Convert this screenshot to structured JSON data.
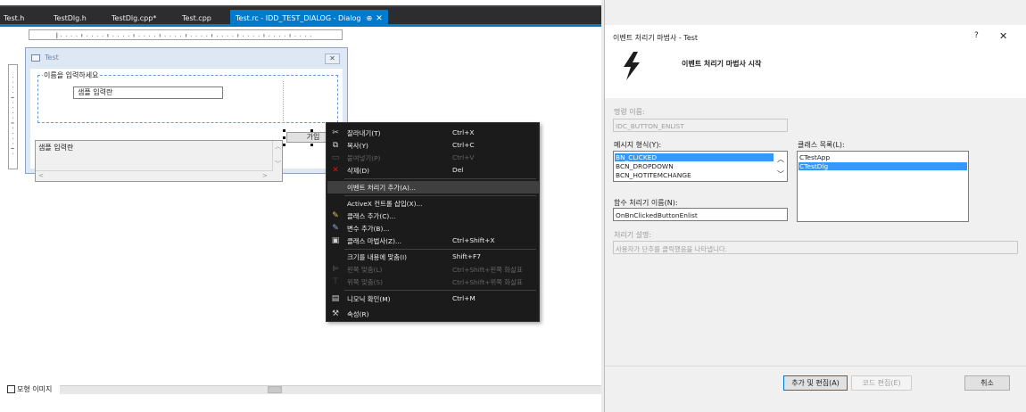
{
  "editor": {
    "tabs": [
      {
        "label": "Test.h"
      },
      {
        "label": "TestDlg.h"
      },
      {
        "label": "TestDlg.cpp*"
      },
      {
        "label": "Test.cpp"
      },
      {
        "label": "Test.rc - IDD_TEST_DIALOG - Dialog",
        "active": true
      }
    ],
    "active_tab_pin": "⊕",
    "active_tab_close": "✕",
    "dialog": {
      "title": "Test",
      "close_glyph": "✕",
      "group_label": "이름을 입력하세요",
      "edit_value": "샘플 입력란",
      "join_button": "가입",
      "list_label": "샘플 입력란"
    },
    "status": {
      "checkbox_label": "모형 이미지"
    }
  },
  "context_menu": {
    "items": [
      {
        "icon": "scissors-icon",
        "glyph": "✂",
        "label": "잘라내기(T)",
        "shortcut": "Ctrl+X",
        "enabled": true
      },
      {
        "icon": "copy-icon",
        "glyph": "⧉",
        "label": "복사(Y)",
        "shortcut": "Ctrl+C",
        "enabled": true
      },
      {
        "icon": "paste-icon",
        "glyph": "📋",
        "label": "붙여넣기(P)",
        "shortcut": "Ctrl+V",
        "enabled": false
      },
      {
        "icon": "delete-icon",
        "glyph": "✕",
        "label": "삭제(D)",
        "shortcut": "Del",
        "enabled": true
      },
      {
        "icon": "",
        "glyph": "",
        "label": "이벤트 처리기 추가(A)...",
        "shortcut": "",
        "enabled": true,
        "highlighted": true
      },
      {
        "icon": "",
        "glyph": "",
        "label": "ActiveX 컨트롤 삽입(X)...",
        "shortcut": "",
        "enabled": true
      },
      {
        "icon": "add-class-icon",
        "glyph": "✎",
        "label": "클래스 추가(C)...",
        "shortcut": "",
        "enabled": true
      },
      {
        "icon": "add-variable-icon",
        "glyph": "✎",
        "label": "변수 추가(B)...",
        "shortcut": "",
        "enabled": true
      },
      {
        "icon": "class-wizard-icon",
        "glyph": "▣",
        "label": "클래스 마법사(Z)...",
        "shortcut": "Ctrl+Shift+X",
        "enabled": true
      },
      {
        "icon": "",
        "glyph": "",
        "label": "크기를 내용에 맞춤(I)",
        "shortcut": "Shift+F7",
        "enabled": true
      },
      {
        "icon": "align-left-icon",
        "glyph": "⊫",
        "label": "왼쪽 맞춤(L)",
        "shortcut": "Ctrl+Shift+왼쪽 화살표",
        "enabled": false
      },
      {
        "icon": "align-top-icon",
        "glyph": "⊤",
        "label": "위쪽 맞춤(S)",
        "shortcut": "Ctrl+Shift+위쪽 화살표",
        "enabled": false
      },
      {
        "icon": "mnemonic-icon",
        "glyph": "▤",
        "label": "니모닉 확인(M)",
        "shortcut": "Ctrl+M",
        "enabled": true
      },
      {
        "icon": "wrench-icon",
        "glyph": "🔧",
        "label": "속성(R)",
        "shortcut": "",
        "enabled": true
      }
    ]
  },
  "wizard": {
    "window_title": "이벤트 처리기 마법사 - Test",
    "help_glyph": "?",
    "close_glyph": "✕",
    "heading": "이벤트 처리기 마법사 시작",
    "command_name_label": "명령 이름:",
    "command_name_value": "IDC_BUTTON_ENLIST",
    "message_type_label": "메시지 형식(Y):",
    "message_types": [
      {
        "label": "BN_CLICKED",
        "selected": true
      },
      {
        "label": "BCN_DROPDOWN",
        "selected": false
      },
      {
        "label": "BCN_HOTITEMCHANGE",
        "selected": false
      }
    ],
    "class_list_label": "클래스 목록(L):",
    "classes": [
      {
        "label": "CTestApp",
        "selected": false
      },
      {
        "label": "CTestDlg",
        "selected": true
      }
    ],
    "handler_name_label": "함수 처리기 이름(N):",
    "handler_name_value": "OnBnClickedButtonEnlist",
    "handler_desc_label": "처리기 설명:",
    "handler_desc_value": "사용자가 단추를 클릭했음을 나타냅니다.",
    "buttons": {
      "add_edit": "추가 및 편집(A)",
      "edit_code": "코드 편집(E)",
      "cancel": "취소"
    }
  }
}
